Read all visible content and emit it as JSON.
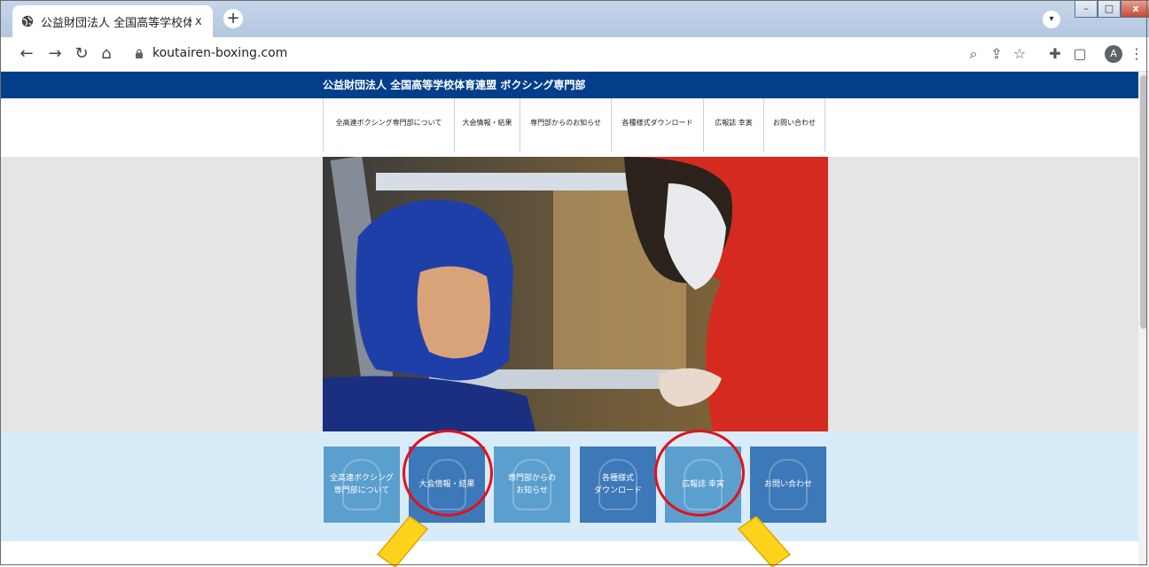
{
  "browser": {
    "tab_title": "公益財団法人 全国高等学校体育",
    "tab_close": "x",
    "new_tab": "+",
    "url": "koutairen-boxing.com",
    "avatar_letter": "A"
  },
  "site": {
    "title": "公益財団法人 全国高等学校体育連盟 ボクシング専門部",
    "menu": [
      "全高連ボクシング専門部について",
      "大会情報・結果",
      "専門部からのお知らせ",
      "各種様式ダウンロード",
      "広報誌 幸寅",
      "お問い合わせ"
    ],
    "buttons": [
      {
        "label": "全高連ボクシング\n専門部について",
        "color": "#5b9fcf"
      },
      {
        "label": "大会情報・結果",
        "color": "#3d78b8"
      },
      {
        "label": "専門部からの\nお知らせ",
        "color": "#5b9fcf"
      },
      {
        "label": "各種様式\nダウンロード",
        "color": "#3d78b8"
      },
      {
        "label": "広報誌 幸寅",
        "color": "#5b9fcf"
      },
      {
        "label": "お問い合わせ",
        "color": "#3d78b8"
      }
    ]
  },
  "colors": {
    "header_blue": "#023e8a",
    "annotation_red": "#e4101b",
    "annotation_arrow": "#ffd21c"
  }
}
